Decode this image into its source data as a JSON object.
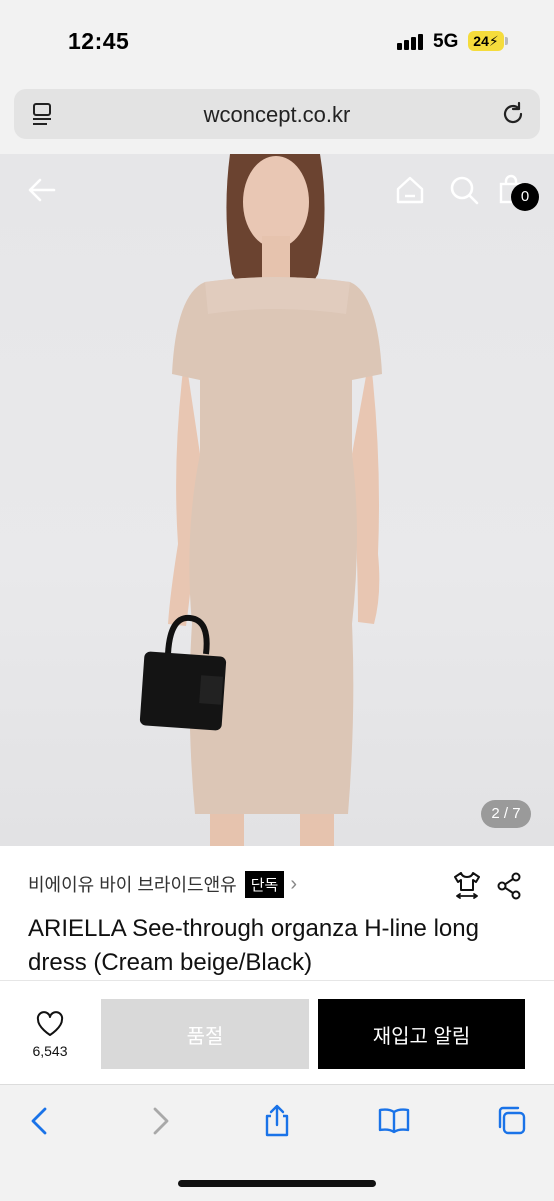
{
  "status": {
    "time": "12:45",
    "network": "5G",
    "battery": "24"
  },
  "browser": {
    "url": "wconcept.co.kr"
  },
  "gallery": {
    "indicator": "2 / 7",
    "bag_count": "0"
  },
  "product": {
    "brand": "비에이유 바이 브라이드앤유",
    "badge": "단독",
    "title": "ARIELLA See-through organza H-line long dress (Cream beige/Black)"
  },
  "actions": {
    "like_count": "6,543",
    "soldout_label": "품절",
    "restock_label": "재입고 알림"
  },
  "colors": {
    "accent": "#000000",
    "soldout_bg": "#d9d9d9",
    "safari_blue": "#1a73e8",
    "dress": "#dcc6b6"
  }
}
